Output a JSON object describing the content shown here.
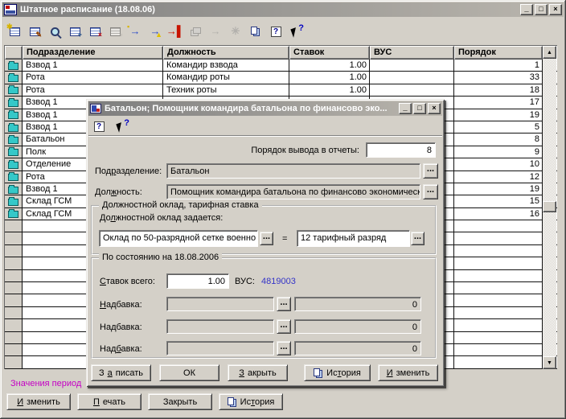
{
  "glyphs": {
    "minimize": "_",
    "maximize": "□",
    "close": "×",
    "dots": "...",
    "scroll_up": "▲",
    "scroll_down": "▼"
  },
  "colors": {
    "titlebar_start": "#7d7d7d",
    "titlebar_end": "#bab6ae",
    "vus_value": "#3434c8",
    "footer_label": "#c400c4"
  },
  "window": {
    "title": "Штатное расписание (18.08.06)"
  },
  "toolbar": {
    "icons": [
      {
        "name": "create-record-icon",
        "type": "sheet",
        "badge": "✱",
        "badge_color": "#d8b400",
        "badge_pos": "tl"
      },
      {
        "name": "edit-record-icon",
        "type": "sheet",
        "badge": "✎",
        "badge_color": "#904000",
        "badge_pos": "br"
      },
      {
        "name": "preview-record-icon",
        "type": "mag"
      },
      {
        "name": "add-record-icon",
        "type": "sheet",
        "badge": "+",
        "badge_color": "#104080",
        "badge_pos": "br"
      },
      {
        "name": "delete-record-icon",
        "type": "sheet",
        "badge": "×",
        "badge_color": "#cc1010",
        "badge_pos": "br"
      },
      {
        "name": "copy-record-icon",
        "type": "sheet",
        "badge": "▫",
        "badge_color": "#707070",
        "badge_pos": "br",
        "disabled": true
      },
      {
        "name": "move-record-icon",
        "type": "arrow",
        "color": "#2848c8",
        "badge": "▪",
        "badge_color": "#d8b400",
        "badge_pos": "tl"
      },
      {
        "name": "move-record-history-icon",
        "type": "arrow",
        "color": "#2848c8",
        "badge": "▲",
        "badge_color": "#e0c000",
        "badge_pos": "br"
      },
      {
        "name": "move-to-end-icon",
        "type": "arrowbar",
        "color": "#c81400"
      },
      {
        "name": "cascade-windows-icon",
        "type": "cascade",
        "disabled": true
      },
      {
        "name": "transfer-record-icon",
        "type": "arrow",
        "color": "#909090",
        "disabled": true
      },
      {
        "name": "group-operation-icon",
        "type": "star",
        "color": "#909090",
        "disabled": true
      },
      {
        "name": "copy-buffer-icon",
        "type": "copy"
      },
      {
        "name": "help-icon",
        "type": "help"
      },
      {
        "name": "context-help-icon",
        "type": "helpcursor"
      }
    ]
  },
  "table": {
    "columns": [
      "",
      "Подразделение",
      "Должность",
      "Ставок",
      "ВУС",
      "Порядок"
    ],
    "rows": [
      {
        "unit": "Взвод 1",
        "position": "Командир взвода",
        "rate": "1.00",
        "vus": "",
        "order": "1"
      },
      {
        "unit": "Рота",
        "position": "Командир роты",
        "rate": "1.00",
        "vus": "",
        "order": "33"
      },
      {
        "unit": "Рота",
        "position": "Техник роты",
        "rate": "1.00",
        "vus": "",
        "order": "18"
      },
      {
        "unit": "Взвод 1",
        "position": "",
        "rate": "",
        "vus": "",
        "order": "17"
      },
      {
        "unit": "Взвод 1",
        "position": "",
        "rate": "",
        "vus": "",
        "order": "19"
      },
      {
        "unit": "Взвод 1",
        "position": "",
        "rate": "",
        "vus": "",
        "order": "5"
      },
      {
        "unit": "Батальон",
        "position": "",
        "rate": "",
        "vus": "",
        "order": "8"
      },
      {
        "unit": "Полк",
        "position": "",
        "rate": "",
        "vus": "",
        "order": "9"
      },
      {
        "unit": "Отделение",
        "position": "",
        "rate": "",
        "vus": "",
        "order": "10"
      },
      {
        "unit": "Рота",
        "position": "",
        "rate": "",
        "vus": "",
        "order": "12"
      },
      {
        "unit": "Взвод 1",
        "position": "",
        "rate": "",
        "vus": "",
        "order": "19"
      },
      {
        "unit": "Склад ГСМ",
        "position": "",
        "rate": "",
        "vus": "",
        "order": "15"
      },
      {
        "unit": "Склад ГСМ",
        "position": "",
        "rate": "",
        "vus": "",
        "order": "16"
      }
    ],
    "empty_row_count": 12
  },
  "dialog": {
    "title": "Батальон; Помощник командира батальона по финансово эко...",
    "toolbar_icons": [
      {
        "name": "dialog-help-icon",
        "type": "help"
      },
      {
        "name": "dialog-context-help-icon",
        "type": "helpcursor"
      }
    ],
    "order_label": "Порядок вывода в отчеты:",
    "order_value": "8",
    "unit_label": "Под&разделение:",
    "unit_value": "Батальон",
    "position_label": "Дол&жность:",
    "position_value": "Помощник командира батальона по финансово экономическ",
    "salary_group": {
      "title": "Должностной оклад, тарифная ставка",
      "subtitle": "До&лжностной оклад задается:",
      "salary_type": "Оклад по 50-разрядной сетке военно",
      "equals": "=",
      "grade": "12 тарифный разряд"
    },
    "state_group": {
      "title": "По состоянию на 18.08.2006",
      "rates_label": "&Ставок всего:",
      "rates_value": "1.00",
      "vus_label": "ВУС:",
      "vus_value": "4819003",
      "allowances": [
        {
          "label": "&Надбавка:",
          "value": "",
          "amount": "0"
        },
        {
          "label": "На&дбавка:",
          "value": "",
          "amount": "0"
        },
        {
          "label": "Над&бавка:",
          "value": "",
          "amount": "0"
        }
      ]
    },
    "buttons": {
      "save": "З&аписать",
      "ok": "ОК",
      "close": "&Закрыть",
      "history": "Ис&тория",
      "edit": "&Изменить"
    }
  },
  "footer": {
    "group_label": "Значения период",
    "buttons": {
      "edit": "&Изменить",
      "print": "&Печать",
      "close": "Закрыть",
      "history": "Ис&тория"
    }
  }
}
